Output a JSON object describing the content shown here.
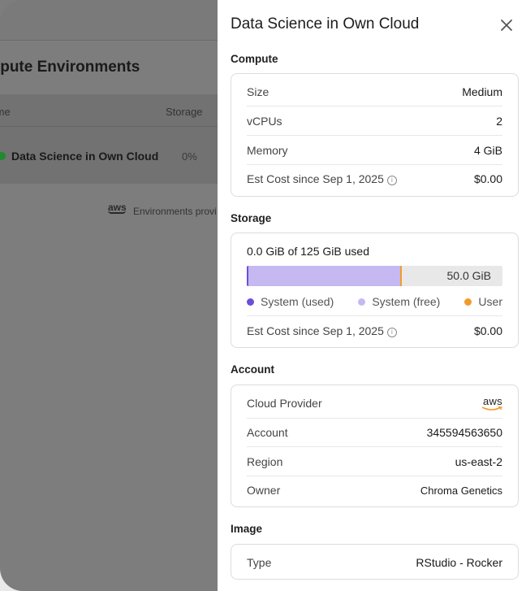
{
  "background": {
    "page_title": "Compute Environments",
    "table_headers": {
      "name": "Name",
      "storage": "Storage"
    },
    "row": {
      "name": "Data Science in Own Cloud",
      "storage": "0%"
    },
    "footer_logo": "aws",
    "footer_text": "Environments provi"
  },
  "panel": {
    "title": "Data Science in Own Cloud",
    "close_icon": "close-icon",
    "compute": {
      "label": "Compute",
      "rows": [
        {
          "key": "Size",
          "value": "Medium"
        },
        {
          "key": "vCPUs",
          "value": "2"
        },
        {
          "key": "Memory",
          "value": "4 GiB"
        },
        {
          "key": "Est Cost since Sep 1, 2025",
          "value": "$0.00"
        }
      ]
    },
    "storage": {
      "label": "Storage",
      "used_text": "0.0 GiB of 125 GiB used",
      "bar_free_label": "50.0 GiB",
      "bar": {
        "system_used_fraction": 0.0,
        "system_free_fraction": 0.6
      },
      "legend": [
        "System (used)",
        "System (free)",
        "User"
      ],
      "cost_key": "Est Cost since Sep 1, 2025",
      "cost_value": "$0.00"
    },
    "account": {
      "label": "Account",
      "provider_key": "Cloud Provider",
      "provider_logo": "aws",
      "rows": [
        {
          "key": "Account",
          "value": "345594563650"
        },
        {
          "key": "Region",
          "value": "us-east-2"
        },
        {
          "key": "Owner",
          "value": "Chroma Genetics"
        }
      ]
    },
    "image": {
      "label": "Image",
      "rows": [
        {
          "key": "Type",
          "value": "RStudio - Rocker"
        }
      ]
    }
  },
  "colors": {
    "system_used": "#6b4fd8",
    "system_free": "#c6b9f1",
    "user": "#f29b2a",
    "status_running": "#1f8a2e"
  }
}
